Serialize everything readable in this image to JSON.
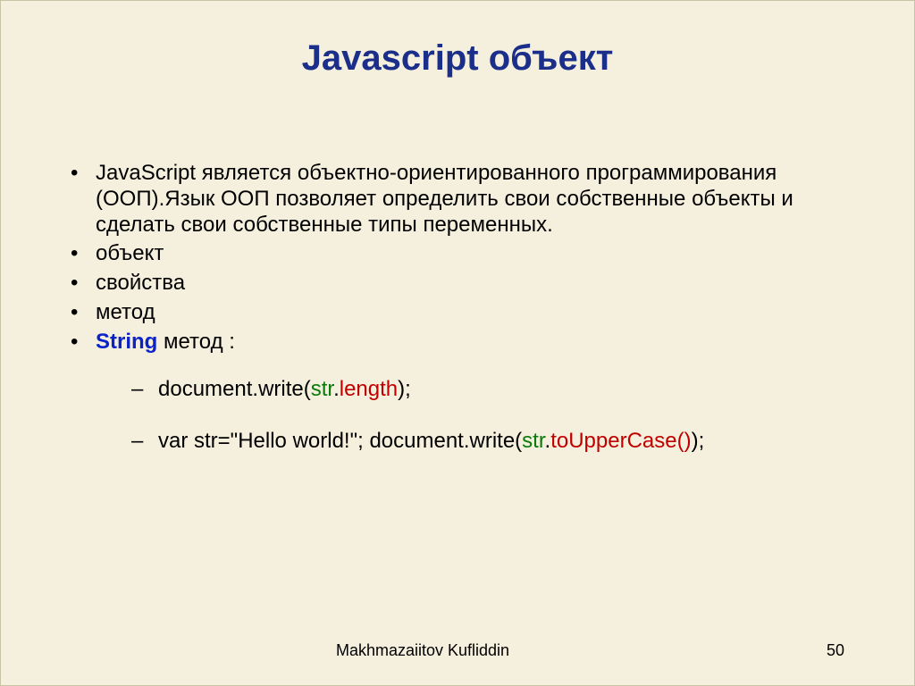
{
  "title": "Javascript объект",
  "bullets": {
    "b1": "JavaScript является объектно-ориентированного программирования (ООП).Язык ООП позволяет определить свои собственные объекты и сделать свои собственные типы переменных.",
    "b2": "объект",
    "b3": "свойства",
    "b4": "метод",
    "b5_string": "String",
    "b5_rest": " метод :"
  },
  "code": {
    "line1_pre": "document.write(",
    "line1_str": "str",
    "line1_dot": ".",
    "line1_len": "length",
    "line1_post": ");",
    "line2_pre": "var str=\"Hello world!\"; document.write(",
    "line2_str": "str",
    "line2_dot": ".",
    "line2_fn": "toUpperCase()",
    "line2_post": ");"
  },
  "footer": {
    "author": "Makhmazaiitov Kufliddin",
    "page": "50"
  }
}
